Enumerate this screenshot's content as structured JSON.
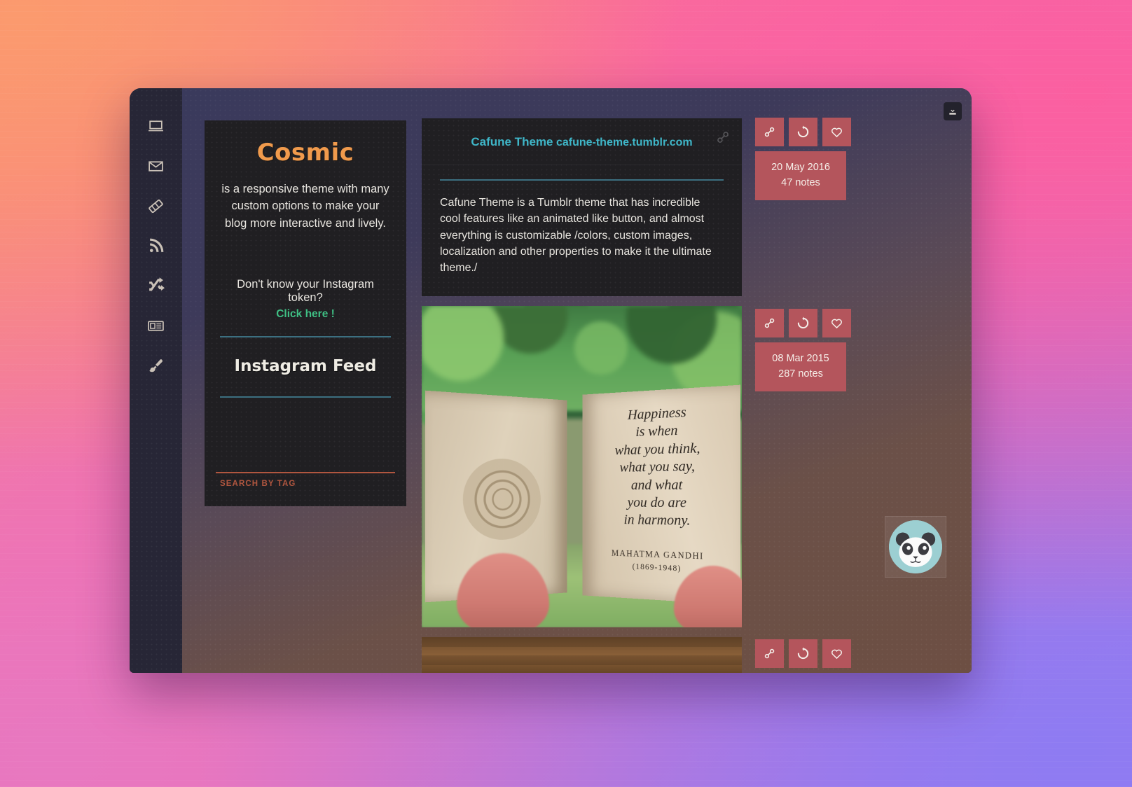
{
  "window": {
    "download_button": "download-icon"
  },
  "sidebar": {
    "items": [
      {
        "name": "sidebar-item-home",
        "icon": "laptop-icon"
      },
      {
        "name": "sidebar-item-ask",
        "icon": "envelope-icon"
      },
      {
        "name": "sidebar-item-tags",
        "icon": "tag-icon"
      },
      {
        "name": "sidebar-item-rss",
        "icon": "rss-icon"
      },
      {
        "name": "sidebar-item-random",
        "icon": "shuffle-icon"
      },
      {
        "name": "sidebar-item-archive",
        "icon": "newspaper-icon"
      },
      {
        "name": "sidebar-item-theme",
        "icon": "paintbrush-icon"
      }
    ]
  },
  "left_column": {
    "blog_title": "Cosmic",
    "blog_description": "is a responsive theme with many custom options to make your blog more interactive and lively.",
    "instagram_token_question": "Don't know your Instagram token?",
    "instagram_token_link": "Click here !",
    "instagram_feed_title": "Instagram Feed",
    "search_by_tag_label": "SEARCH BY TAG",
    "search_by_tag_placeholder": "SEARCH BY TAG"
  },
  "posts": [
    {
      "type": "link",
      "title": "Cafune Theme",
      "url": "cafune-theme.tumblr.com",
      "body": "Cafune Theme is a Tumblr theme that has incredible cool features like an animated like button, and almost everything is customizable /colors, custom images, localization and other properties to make it the ultimate theme./",
      "link_icon": "link-icon",
      "meta": {
        "date": "20 May 2016",
        "notes": "47 notes",
        "buttons": [
          {
            "name": "permalink-button",
            "icon": "link-icon"
          },
          {
            "name": "reblog-button",
            "icon": "reblog-icon"
          },
          {
            "name": "like-button",
            "icon": "heart-icon"
          }
        ]
      }
    },
    {
      "type": "photo",
      "image_alt": "open miniature book held between two fingers with a Gandhi quote",
      "quote_lines": [
        "Happiness",
        "is when",
        "what you think,",
        "what you say,",
        "and what",
        "you do are",
        "in harmony."
      ],
      "quote_author": "MAHATMA GANDHI",
      "quote_years": "(1869-1948)",
      "meta": {
        "date": "08 Mar 2015",
        "notes": "287 notes",
        "buttons": [
          {
            "name": "permalink-button",
            "icon": "link-icon"
          },
          {
            "name": "reblog-button",
            "icon": "reblog-icon"
          },
          {
            "name": "like-button",
            "icon": "heart-icon"
          }
        ]
      }
    },
    {
      "type": "photo",
      "image_alt": "wooden plank surface photo, partially visible",
      "meta": {
        "buttons": [
          {
            "name": "permalink-button",
            "icon": "link-icon"
          },
          {
            "name": "reblog-button",
            "icon": "reblog-icon"
          },
          {
            "name": "like-button",
            "icon": "heart-icon"
          }
        ]
      }
    }
  ],
  "avatar": {
    "name": "panda-avatar",
    "background_color": "#9ccfd2"
  },
  "colors": {
    "accent_orange": "#f09a4c",
    "accent_teal": "#3fb6c8",
    "accent_green": "#3fbf84",
    "accent_red": "#b4555c",
    "rule_teal": "#3c6f80",
    "rule_red": "#b0563f",
    "panel_bg": "#201f22",
    "rail_bg": "#272636"
  }
}
